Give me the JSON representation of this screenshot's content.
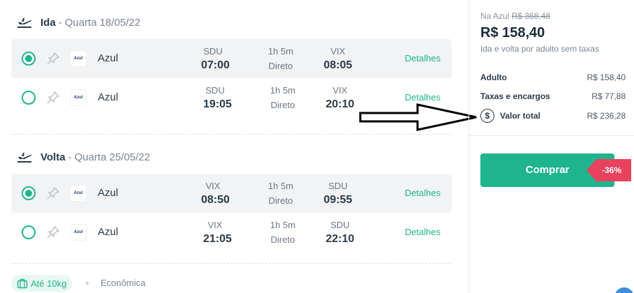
{
  "outbound": {
    "label": "Ida",
    "date": "Quarta 18/05/22",
    "flights": [
      {
        "selected": true,
        "airline": "Azul",
        "logo": "Azul",
        "from": "SDU",
        "dep": "07:00",
        "duration": "1h 5m",
        "stops": "Direto",
        "to": "VIX",
        "arr": "08:05",
        "details": "Detalhes"
      },
      {
        "selected": false,
        "airline": "Azul",
        "logo": "Azul",
        "from": "SDU",
        "dep": "19:05",
        "duration": "1h 5m",
        "stops": "Direto",
        "to": "VIX",
        "arr": "20:10",
        "details": "Detalhes"
      }
    ]
  },
  "return": {
    "label": "Volta",
    "date": "Quarta 25/05/22",
    "flights": [
      {
        "selected": true,
        "airline": "Azul",
        "logo": "Azul",
        "from": "VIX",
        "dep": "08:50",
        "duration": "1h 5m",
        "stops": "Direto",
        "to": "SDU",
        "arr": "09:55",
        "details": "Detalhes"
      },
      {
        "selected": false,
        "airline": "Azul",
        "logo": "Azul",
        "from": "VIX",
        "dep": "21:05",
        "duration": "1h 5m",
        "stops": "Direto",
        "to": "SDU",
        "arr": "22:10",
        "details": "Detalhes"
      }
    ]
  },
  "footer": {
    "baggage": "Até 10kg",
    "cabin": "Econômica"
  },
  "summary": {
    "na_label": "Na Azul",
    "old_price": "R$ 368,48",
    "price": "R$ 158,40",
    "note": "Ida e volta por adulto sem taxas",
    "lines": [
      {
        "label": "Adulto",
        "value": "R$ 158,40"
      },
      {
        "label": "Taxas e encargos",
        "value": "R$ 77,88"
      },
      {
        "label": "Valor total",
        "value": "R$ 236,28"
      }
    ],
    "buy_label": "Comprar",
    "discount": "-36%"
  },
  "colors": {
    "accent": "#1fb58c",
    "discount": "#e8425f",
    "text": "#2b3a4a"
  },
  "icons": {
    "departure": "plane-takeoff-icon",
    "arrival": "plane-takeoff-icon",
    "pin": "pin-icon",
    "bag": "luggage-icon",
    "total": "dollar-circle-icon"
  }
}
